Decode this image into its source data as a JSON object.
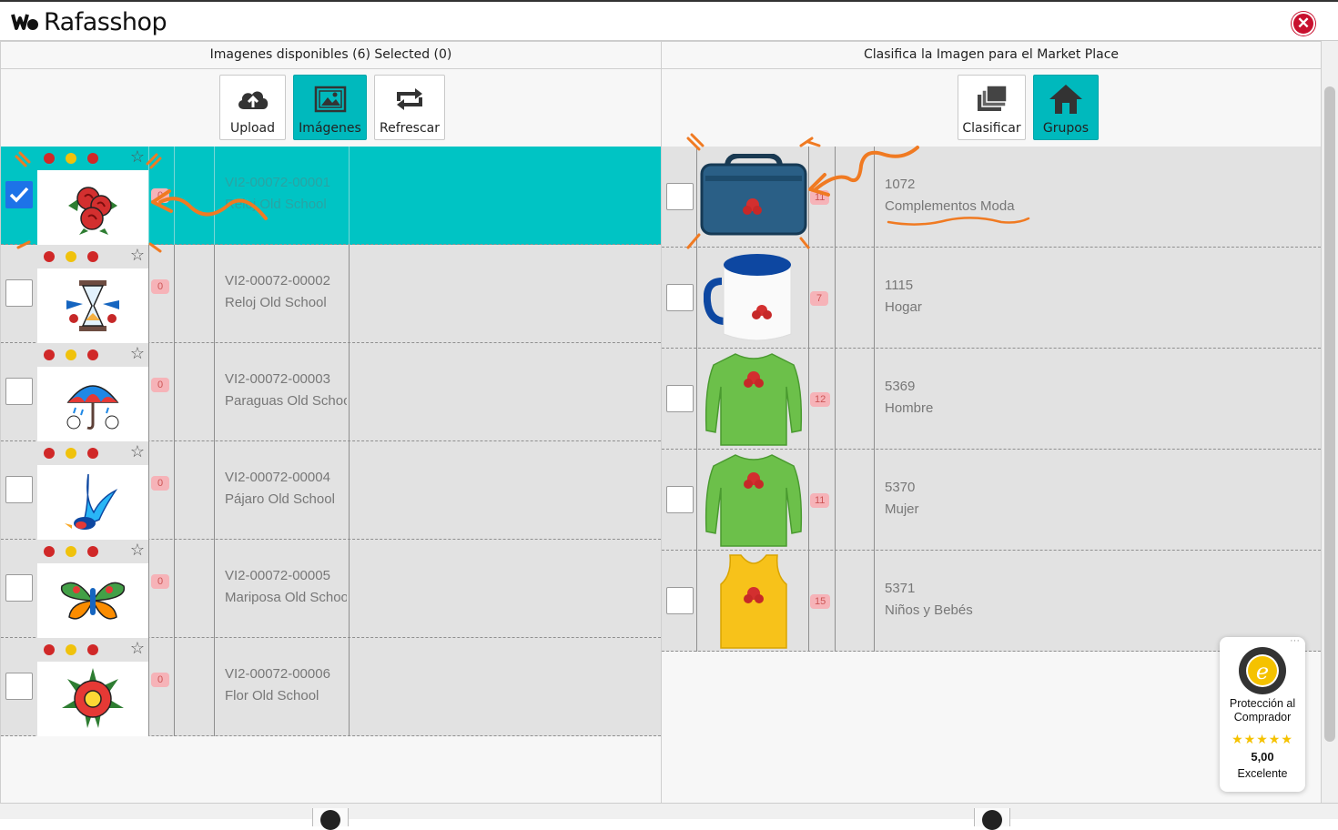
{
  "app": {
    "name": "Rafasshop"
  },
  "left_panel": {
    "header": "Imagenes disponibles (6) Selected (0)",
    "toolbar": [
      {
        "label": "Upload",
        "icon": "cloud-upload-icon",
        "active": false
      },
      {
        "label": "Imágenes",
        "icon": "images-icon",
        "active": true
      },
      {
        "label": "Refrescar",
        "icon": "refresh-icon",
        "active": false
      }
    ],
    "rows": [
      {
        "code": "VI2-00072-00001",
        "name": "Reloj Old School",
        "count": "0",
        "checked": true,
        "image": "rose-tattoo-image"
      },
      {
        "code": "VI2-00072-00002",
        "name": "Reloj Old School",
        "count": "0",
        "checked": false,
        "image": "hourglass-tattoo-image"
      },
      {
        "code": "VI2-00072-00003",
        "name": "Paraguas Old School",
        "count": "0",
        "checked": false,
        "image": "umbrella-tattoo-image"
      },
      {
        "code": "VI2-00072-00004",
        "name": "Pájaro Old School",
        "count": "0",
        "checked": false,
        "image": "swallow-tattoo-image"
      },
      {
        "code": "VI2-00072-00005",
        "name": "Mariposa Old School",
        "count": "0",
        "checked": false,
        "image": "butterfly-tattoo-image"
      },
      {
        "code": "VI2-00072-00006",
        "name": "Flor Old School",
        "count": "0",
        "checked": false,
        "image": "flower-tattoo-image"
      }
    ]
  },
  "right_panel": {
    "header": "Clasifica la Imagen para el Market Place",
    "toolbar": [
      {
        "label": "Clasificar",
        "icon": "layers-icon",
        "active": false
      },
      {
        "label": "Grupos",
        "icon": "home-icon",
        "active": true
      }
    ],
    "rows": [
      {
        "id": "1072",
        "name": "Complementos Moda",
        "count": "11",
        "image": "bag-product-image"
      },
      {
        "id": "1115",
        "name": "Hogar",
        "count": "7",
        "image": "mug-product-image"
      },
      {
        "id": "5369",
        "name": "Hombre",
        "count": "12",
        "image": "green-shirt-product-image"
      },
      {
        "id": "5370",
        "name": "Mujer",
        "count": "11",
        "image": "green-shirt-product-image"
      },
      {
        "id": "5371",
        "name": "Niños y Bebés",
        "count": "15",
        "image": "yellow-tank-product-image"
      }
    ]
  },
  "trust_badge": {
    "line1": "Protección al",
    "line2": "Comprador",
    "rating": "5,00",
    "verdict": "Excelente",
    "stars": 5,
    "more": "···"
  },
  "colors": {
    "accent": "#00c4c4",
    "close": "#c8102e",
    "annotation": "#f07a22",
    "checkbox": "#1d73e8"
  }
}
